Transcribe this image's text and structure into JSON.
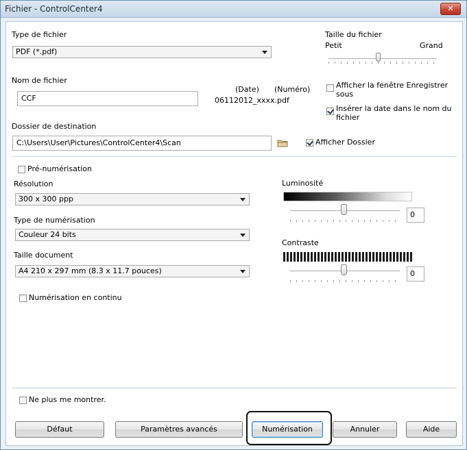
{
  "window": {
    "title": "Fichier - ControlCenter4",
    "close_icon": "✕"
  },
  "file_type": {
    "label": "Type de fichier",
    "value": "PDF (*.pdf)"
  },
  "file_size": {
    "label": "Taille du fichier",
    "min_label": "Petit",
    "max_label": "Grand"
  },
  "file_name": {
    "label": "Nom de fichier",
    "value": "CCF",
    "date_header": "(Date)",
    "number_header": "(Numéro)",
    "example": "06112012_xxxx.pdf"
  },
  "options": {
    "show_save_as": {
      "label": "Afficher la fenêtre Enregistrer sous",
      "checked": false
    },
    "insert_date": {
      "label": "Insérer la date dans le nom du fichier",
      "checked": true
    }
  },
  "destination": {
    "label": "Dossier de destination",
    "value": "C:\\Users\\User\\Pictures\\ControlCenter4\\Scan",
    "browse_icon": "folder-icon",
    "show_folder": {
      "label": "Afficher Dossier",
      "checked": true
    }
  },
  "prescan": {
    "label": "Pré-numérisation",
    "checked": false
  },
  "resolution": {
    "label": "Résolution",
    "value": "300 x 300 ppp"
  },
  "scan_type": {
    "label": "Type de numérisation",
    "value": "Couleur 24 bits"
  },
  "doc_size": {
    "label": "Taille document",
    "value": "A4 210 x 297 mm (8.3 x 11.7 pouces)"
  },
  "continuous": {
    "label": "Numérisation en continu",
    "checked": false
  },
  "brightness": {
    "label": "Luminosité",
    "value": "0"
  },
  "contrast": {
    "label": "Contraste",
    "value": "0"
  },
  "dont_show": {
    "label": "Ne plus me montrer.",
    "checked": false
  },
  "buttons": {
    "default": "Défaut",
    "advanced": "Paramètres avancés",
    "scan": "Numérisation",
    "cancel": "Annuler",
    "help": "Aide"
  },
  "colors": {
    "title_bar": "#c7d7ea",
    "close_button": "#c64a38",
    "focus_border": "#3c7fb1"
  }
}
